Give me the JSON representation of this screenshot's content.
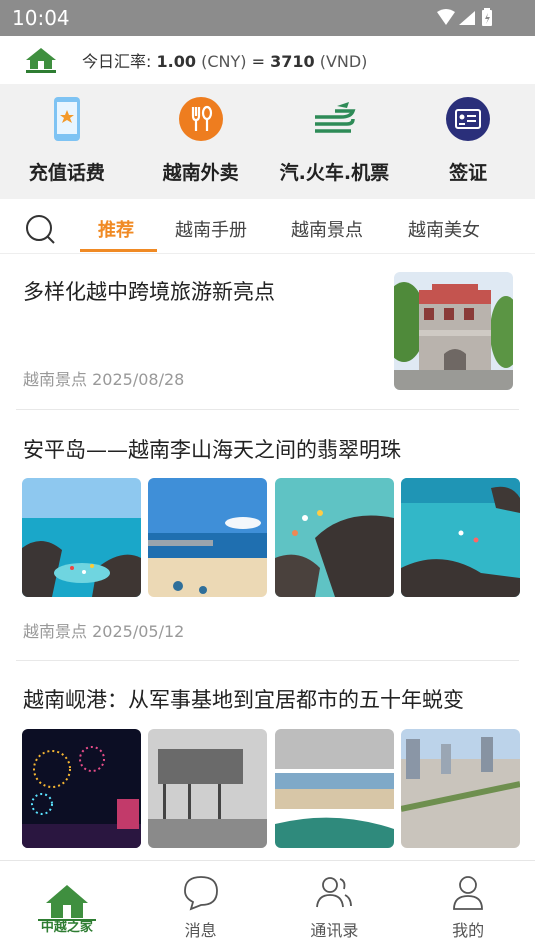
{
  "status_bar": {
    "time": "10:04"
  },
  "exchange": {
    "prefix": "今日汇率:",
    "cny_value": "1.00",
    "cny_unit": "(CNY)",
    "equals": "=",
    "vnd_value": "3710",
    "vnd_unit": "(VND)"
  },
  "services": [
    {
      "label": "充值话费",
      "icon": "phone-recharge-icon"
    },
    {
      "label": "越南外卖",
      "icon": "food-delivery-icon"
    },
    {
      "label": "汽.火车.机票",
      "icon": "transport-icon"
    },
    {
      "label": "签证",
      "icon": "visa-card-icon"
    }
  ],
  "tabs": [
    {
      "label": "推荐",
      "active": true
    },
    {
      "label": "越南手册",
      "active": false
    },
    {
      "label": "越南景点",
      "active": false
    },
    {
      "label": "越南美女",
      "active": false
    }
  ],
  "articles": [
    {
      "title": "多样化越中跨境旅游新亮点",
      "category": "越南景点",
      "date": "2025/08/28"
    },
    {
      "title": "安平岛——越南李山海天之间的翡翠明珠",
      "category": "越南景点",
      "date": "2025/05/12"
    },
    {
      "title": "越南岘港：从军事基地到宜居都市的五十年蜕变",
      "category": "",
      "date": ""
    }
  ],
  "bottom_nav": [
    {
      "label": "中越之家",
      "icon": "home-logo-icon",
      "active": true
    },
    {
      "label": "消息",
      "icon": "chat-icon",
      "active": false
    },
    {
      "label": "通讯录",
      "icon": "contacts-icon",
      "active": false
    },
    {
      "label": "我的",
      "icon": "profile-icon",
      "active": false
    }
  ],
  "colors": {
    "accent": "#f08a24",
    "brand_green": "#2e7d32",
    "visa_navy": "#2a2f7a"
  }
}
